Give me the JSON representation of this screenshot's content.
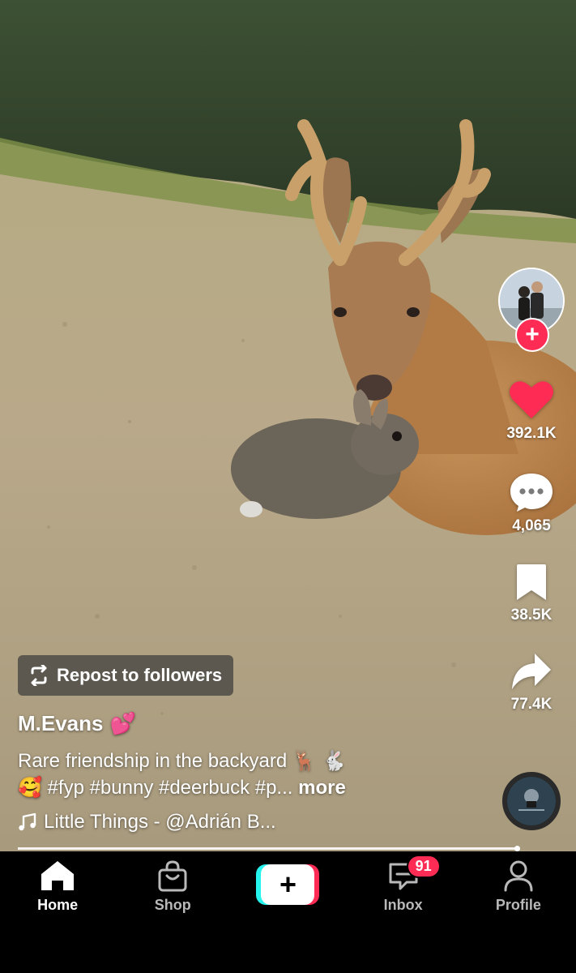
{
  "video": {
    "description_hidden": ""
  },
  "rail": {
    "likes": "392.1K",
    "comments": "4,065",
    "saves": "38.5K",
    "shares": "77.4K"
  },
  "repost": {
    "label": "Repost to followers"
  },
  "post": {
    "author": "M.Evans",
    "author_emoji": "💕",
    "caption_line1": "Rare friendship in the backyard 🦌 🐇",
    "caption_line2": "🥰 #fyp #bunny #deerbuck #p...",
    "more": "more",
    "music": "Little Things - @Adrián B..."
  },
  "progress": {
    "fraction": 0.995
  },
  "nav": {
    "home": "Home",
    "shop": "Shop",
    "inbox": "Inbox",
    "inbox_badge": "91",
    "profile": "Profile",
    "create": "+"
  },
  "colors": {
    "accent": "#fe2c55",
    "cyan": "#25f4ee",
    "like": "#fe2c55"
  },
  "icons": {
    "home": "home-icon",
    "shop": "shopping-bag-icon",
    "inbox": "inbox-icon",
    "profile": "person-icon",
    "like": "heart-icon",
    "comment": "comment-icon",
    "save": "bookmark-icon",
    "share": "share-icon",
    "repost": "repost-icon",
    "music": "music-note-icon"
  }
}
